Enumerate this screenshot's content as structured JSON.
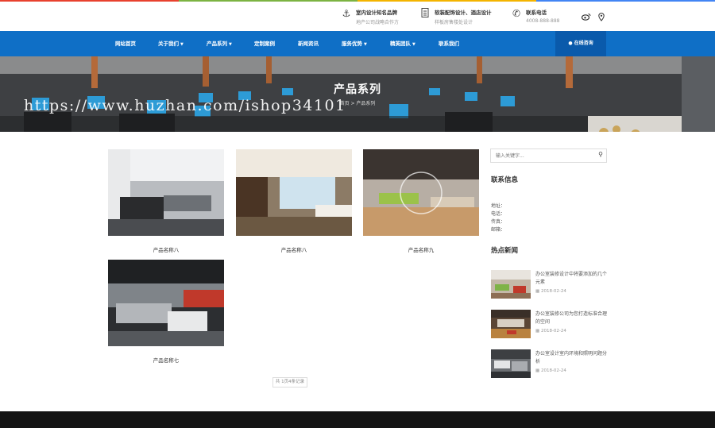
{
  "top_stripe_colors": [
    "#e8412e",
    "#7cb342",
    "#f4b400",
    "#4285f4"
  ],
  "topbar": {
    "items": [
      {
        "icon": "anchor-icon",
        "title": "室内设计知名品牌",
        "subtitle": "地产公司战略合作方"
      },
      {
        "icon": "document-icon",
        "title": "软装配饰设计、酒店设计",
        "subtitle": "样板房售楼处设计"
      },
      {
        "icon": "phone-icon",
        "title": "联系电话",
        "subtitle": "4008-888-888"
      }
    ],
    "social": [
      "weibo-icon",
      "location-pin-icon"
    ]
  },
  "nav": {
    "items": [
      {
        "label": "网站首页",
        "caret": false
      },
      {
        "label": "关于我们",
        "caret": true
      },
      {
        "label": "产品系列",
        "caret": true
      },
      {
        "label": "定制案例",
        "caret": false
      },
      {
        "label": "新闻资讯",
        "caret": false
      },
      {
        "label": "服务优势",
        "caret": true
      },
      {
        "label": "精英团队",
        "caret": true
      },
      {
        "label": "联系我们",
        "caret": false
      }
    ],
    "consult": "在线咨询",
    "accent": "#0f6fc6"
  },
  "banner": {
    "title": "产品系列",
    "breadcrumb": "首页 > 产品系列",
    "watermark": "https://www.huzhan.com/ishop34101"
  },
  "products": [
    {
      "name": "产品名称八"
    },
    {
      "name": "产品名称八"
    },
    {
      "name": "产品名称九"
    },
    {
      "name": "产品名称七"
    }
  ],
  "pager": "共 1页4条记录",
  "sidebar": {
    "search_placeholder": "输入关键字...",
    "contact_heading": "联系信息",
    "contact_lines": [
      "地址：",
      "电话：",
      "传真：",
      "邮箱："
    ],
    "hot_heading": "热点新闻",
    "news": [
      {
        "title": "办公室装修设计中将要添加的几个元素",
        "date": "2018-02-24"
      },
      {
        "title": "办公室装修公司为您打造标准合理的空间",
        "date": "2018-02-24"
      },
      {
        "title": "办公室设计室内环境和照明问题分析",
        "date": "2018-02-24"
      }
    ]
  }
}
